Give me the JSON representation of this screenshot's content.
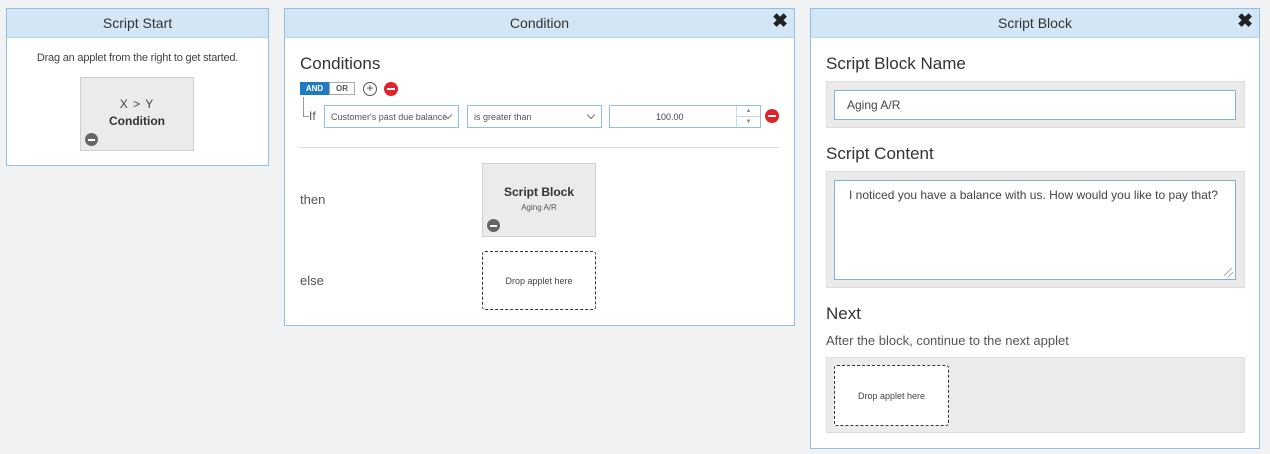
{
  "script_start": {
    "title": "Script Start",
    "hint": "Drag an applet from the right to get started.",
    "applet": {
      "symbol": "X > Y",
      "name": "Condition"
    }
  },
  "condition": {
    "title": "Condition",
    "close": "✖",
    "conditions_heading": "Conditions",
    "and_label": "AND",
    "or_label": "OR",
    "plus_symbol": "+",
    "if_label": "If",
    "field_value": "Customer's past due balance",
    "operator_value": "is greater than",
    "amount_value": "100.00",
    "spin_up": "▲",
    "spin_down": "▼",
    "then_label": "then",
    "else_label": "else",
    "then_applet": {
      "name": "Script Block",
      "sub": "Aging A/R"
    },
    "else_drop": "Drop applet here"
  },
  "script_block": {
    "title": "Script Block",
    "close": "✖",
    "name_heading": "Script Block Name",
    "name_value": "Aging A/R",
    "content_heading": "Script Content",
    "content_value": "I noticed you have a balance with us. How would you like to pay that?",
    "next_heading": "Next",
    "next_note": "After the block, continue to the next applet",
    "next_drop": "Drop applet here"
  }
}
